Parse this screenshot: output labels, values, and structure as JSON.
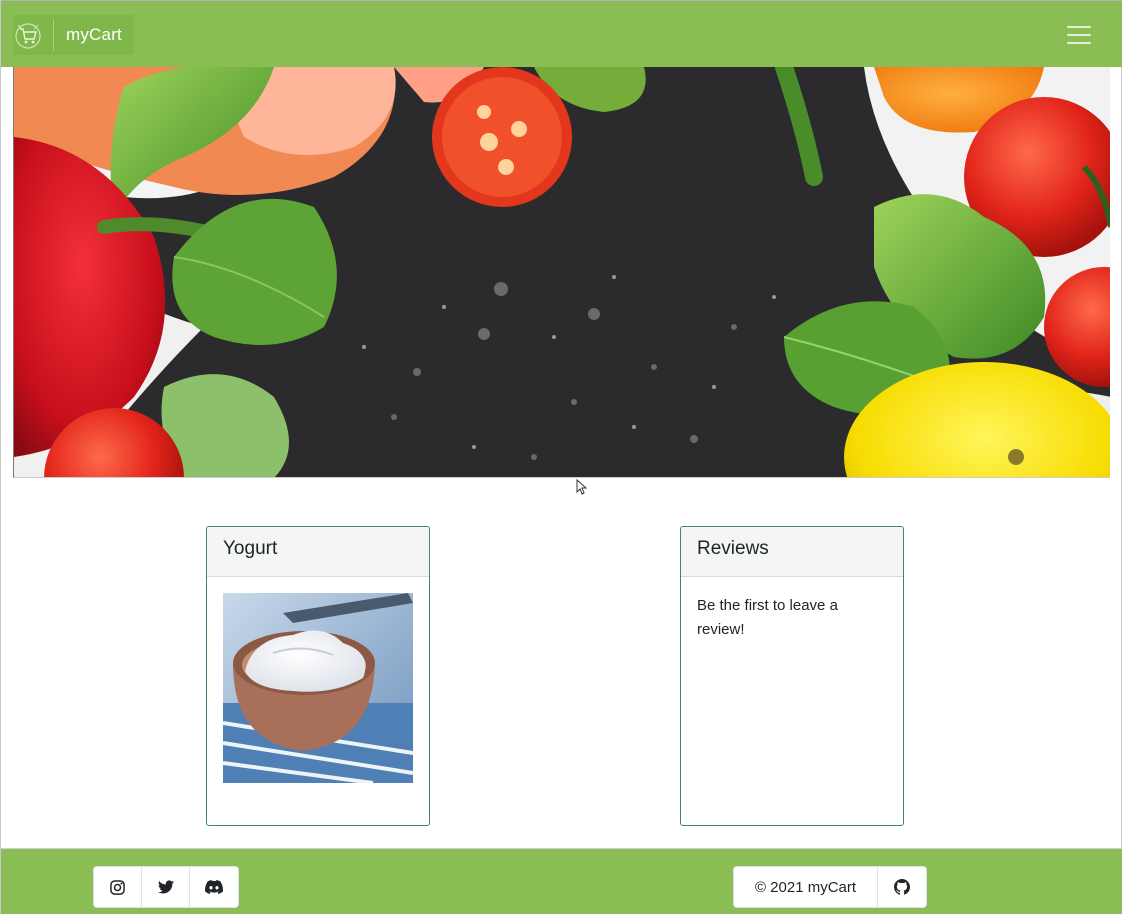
{
  "navbar": {
    "brand_text": "myCart",
    "logo_icon": "cart-logo-icon",
    "menu_icon": "hamburger-menu-icon",
    "background_color": "#8bbd55"
  },
  "hero": {
    "icon": "vegetables-banner-image"
  },
  "product_card": {
    "title": "Yogurt",
    "image_icon": "yogurt-bowl-image"
  },
  "reviews_card": {
    "title": "Reviews",
    "message": "Be the first to leave a review!"
  },
  "footer": {
    "background_color": "#8bbd55",
    "social": [
      {
        "name": "instagram",
        "icon": "instagram-icon"
      },
      {
        "name": "twitter",
        "icon": "twitter-icon"
      },
      {
        "name": "discord",
        "icon": "discord-icon"
      }
    ],
    "copyright": "© 2021 myCart",
    "github_icon": "github-icon"
  }
}
